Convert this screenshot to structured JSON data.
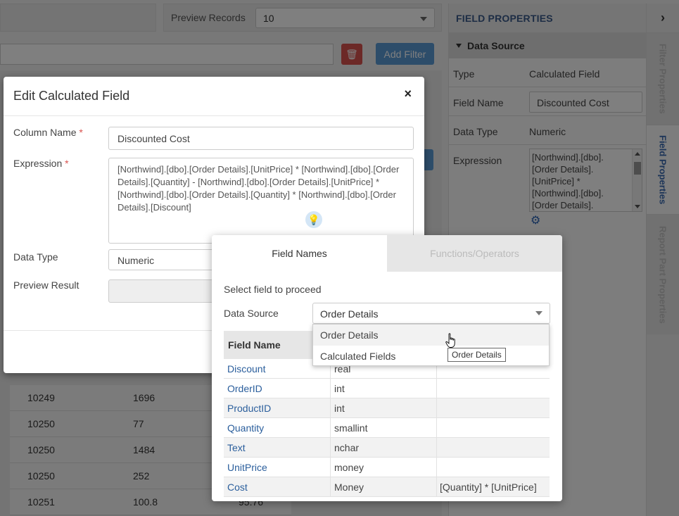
{
  "background": {
    "preview_records_label": "Preview Records",
    "preview_records_value": "10",
    "add_filter_label": "Add Filter",
    "rows": [
      {
        "a": "10249",
        "b": "1696",
        "c": ""
      },
      {
        "a": "10250",
        "b": "77",
        "c": ""
      },
      {
        "a": "10250",
        "b": "1484",
        "c": ""
      },
      {
        "a": "10250",
        "b": "252",
        "c": ""
      },
      {
        "a": "10251",
        "b": "100.8",
        "c": "95.76"
      }
    ]
  },
  "right_panel": {
    "title": "FIELD PROPERTIES",
    "section": "Data Source",
    "type_label": "Type",
    "type_value": "Calculated Field",
    "field_name_label": "Field Name",
    "field_name_value": "Discounted Cost",
    "data_type_label": "Data Type",
    "data_type_value": "Numeric",
    "expression_label": "Expression",
    "expression_value": "[Northwind].[dbo].[Order Details].[UnitPrice] * [Northwind].[dbo].[Order Details]."
  },
  "vertical_tabs": {
    "filter": "Filter Properties",
    "field": "Field Properties",
    "report": "Report Part Properties"
  },
  "dialog": {
    "title": "Edit Calculated Field",
    "column_name_label": "Column Name",
    "column_name_value": "Discounted Cost",
    "expression_label": "Expression",
    "expression_value": "[Northwind].[dbo].[Order Details].[UnitPrice] * [Northwind].[dbo].[Order Details].[Quantity] - [Northwind].[dbo].[Order Details].[UnitPrice] * [Northwind].[dbo].[Order Details].[Quantity] * [Northwind].[dbo].[Order Details].[Discount]",
    "data_type_label": "Data Type",
    "data_type_value": "Numeric",
    "preview_result_label": "Preview Result",
    "required_mark": "*",
    "close_glyph": "×"
  },
  "picker": {
    "tabs": [
      "Field Names",
      "Functions/Operators"
    ],
    "hint": "Select field to proceed",
    "data_source_label": "Data Source",
    "data_source_value": "Order Details",
    "header": "Field Name",
    "dropdown_options": [
      "Order Details",
      "Calculated Fields"
    ],
    "tooltip": "Order Details",
    "rows": [
      {
        "name": "Discount",
        "type": "real",
        "expr": ""
      },
      {
        "name": "OrderID",
        "type": "int",
        "expr": ""
      },
      {
        "name": "ProductID",
        "type": "int",
        "expr": ""
      },
      {
        "name": "Quantity",
        "type": "smallint",
        "expr": ""
      },
      {
        "name": "Text",
        "type": "nchar",
        "expr": ""
      },
      {
        "name": "UnitPrice",
        "type": "money",
        "expr": ""
      },
      {
        "name": "Cost",
        "type": "Money",
        "expr": "[Quantity] * [UnitPrice]"
      }
    ]
  }
}
